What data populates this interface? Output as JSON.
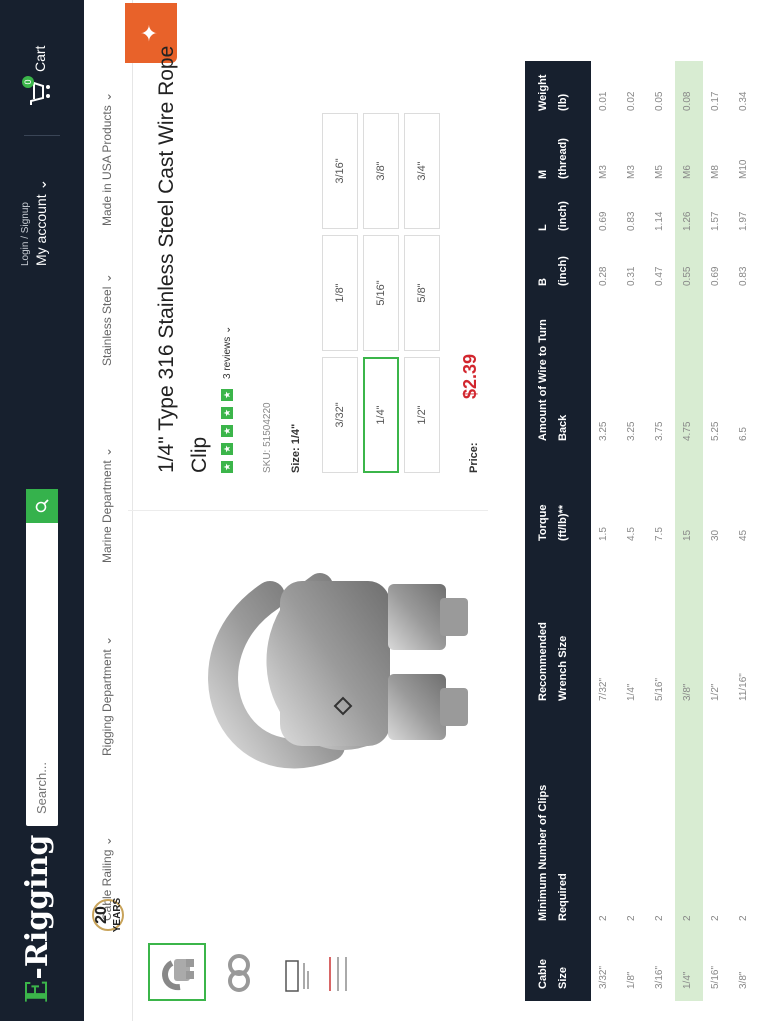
{
  "header": {
    "logo": "E-Rigging",
    "search_placeholder": "Search...",
    "account_small": "Login / Signup",
    "account_label": "My account",
    "cart_label": "Cart",
    "cart_count": "0"
  },
  "nav": {
    "items": [
      "Cable Railing",
      "Rigging Department",
      "Marine Department",
      "Stainless Steel",
      "Made in USA Products"
    ],
    "badge_number": "20",
    "badge_text": "YEARS"
  },
  "product": {
    "title": "1/4\" Type 316 Stainless Steel Cast Wire Rope Clip",
    "rating_stars": 5,
    "reviews": "3 reviews",
    "sku": "SKU: 51504220",
    "size_label": "Size: 1/4\"",
    "sizes": [
      "3/32\"",
      "1/8\"",
      "3/16\"",
      "1/4\"",
      "5/16\"",
      "3/8\"",
      "1/2\"",
      "5/8\"",
      "3/4\""
    ],
    "selected_size": "1/4\"",
    "price_label": "Price:",
    "price": "$2.39"
  },
  "spec_table": {
    "headers": [
      [
        "Cable",
        "Size"
      ],
      [
        "Minimum Number of Clips",
        "Required"
      ],
      [
        "Recommended",
        "Wrench Size"
      ],
      [
        "Torque",
        "(ft/lb)**"
      ],
      [
        "Amount of Wire to Turn",
        "Back"
      ],
      [
        "B",
        "(inch)"
      ],
      [
        "L",
        "(inch)"
      ],
      [
        "M",
        "(thread)"
      ],
      [
        "Weight",
        "(lb)"
      ]
    ],
    "rows": [
      [
        "3/32\"",
        "2",
        "7/32\"",
        "1.5",
        "3.25",
        "0.28",
        "0.69",
        "M3",
        "0.01"
      ],
      [
        "1/8\"",
        "2",
        "1/4\"",
        "4.5",
        "3.25",
        "0.31",
        "0.83",
        "M3",
        "0.02"
      ],
      [
        "3/16\"",
        "2",
        "5/16\"",
        "7.5",
        "3.75",
        "0.47",
        "1.14",
        "M5",
        "0.05"
      ],
      [
        "1/4\"",
        "2",
        "3/8\"",
        "15",
        "4.75",
        "0.55",
        "1.26",
        "M6",
        "0.08"
      ],
      [
        "5/16\"",
        "2",
        "1/2\"",
        "30",
        "5.25",
        "0.69",
        "1.57",
        "M8",
        "0.17"
      ],
      [
        "3/8\"",
        "2",
        "11/16\"",
        "45",
        "6.5",
        "0.83",
        "1.97",
        "M10",
        "0.34"
      ]
    ],
    "highlight_row": 3
  },
  "colors": {
    "brand_dark": "#17202e",
    "accent_green": "#3bb54a",
    "price_red": "#d2262e",
    "tab_orange": "#e8622a",
    "highlight": "#d8ecd2"
  },
  "icons": [
    "search-icon",
    "cart-icon",
    "star-icon",
    "help-icon"
  ]
}
